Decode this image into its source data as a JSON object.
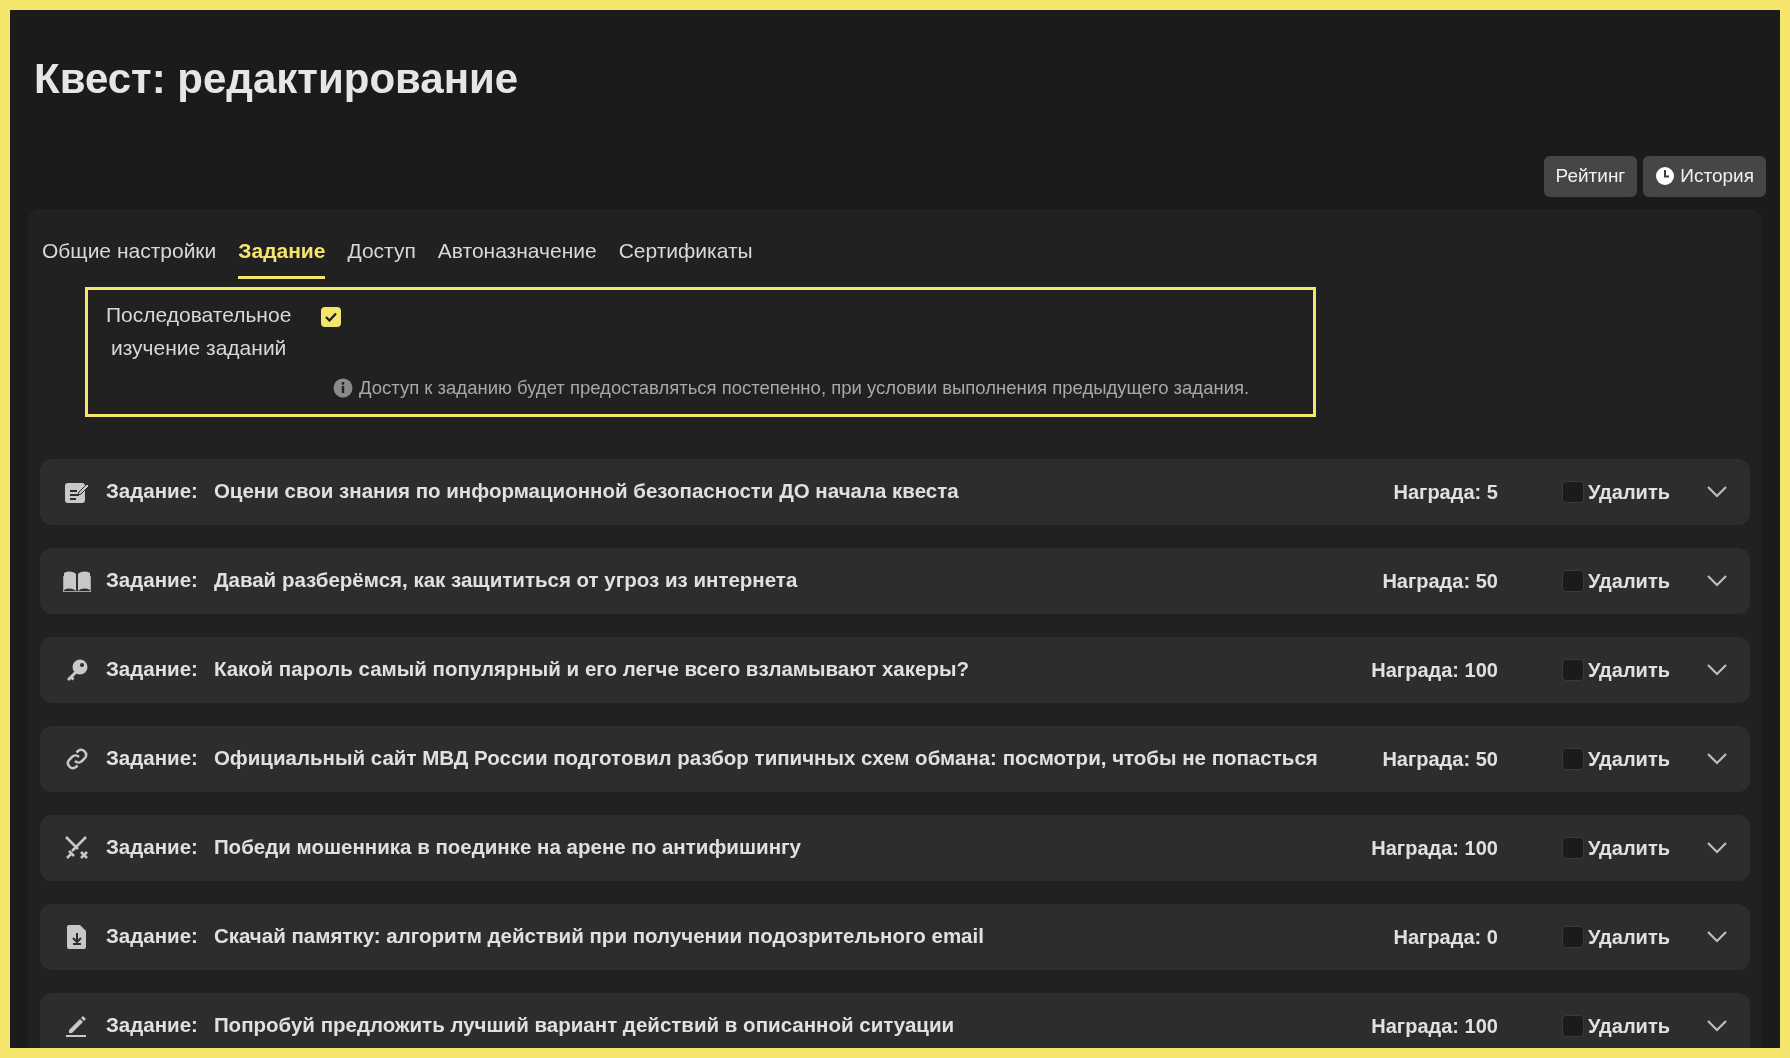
{
  "title": "Квест: редактирование",
  "header_buttons": [
    {
      "kind": "plain",
      "label": "Рейтинг"
    },
    {
      "kind": "history",
      "label": "История"
    }
  ],
  "tabs": [
    {
      "label": "Общие настройки",
      "selected": false
    },
    {
      "label": "Задание",
      "selected": true
    },
    {
      "label": "Доступ",
      "selected": false
    },
    {
      "label": "Автоназначение",
      "selected": false
    },
    {
      "label": "Сертификаты",
      "selected": false
    }
  ],
  "sequential": {
    "label_lines": [
      "Последовательное",
      "изучение заданий"
    ],
    "checked": true,
    "hint": "Доступ к заданию будет предоставляться постепенно, при условии выполнения предыдущего задания."
  },
  "tasks": [
    {
      "kind": "grade",
      "prefix": "Задание:",
      "title": "Оцени свои знания по информационной безопасности ДО начала квеста",
      "reward": "Награда: 5",
      "delete_label": "Удалить",
      "delete_checked": false
    },
    {
      "kind": "book",
      "prefix": "Задание:",
      "title": "Давай разберёмся, как защититься от угроз из интернета",
      "reward": "Награда: 50",
      "delete_label": "Удалить",
      "delete_checked": false
    },
    {
      "kind": "key",
      "prefix": "Задание:",
      "title": "Какой пароль самый популярный и его легче всего взламывают хакеры?",
      "reward": "Награда: 100",
      "delete_label": "Удалить",
      "delete_checked": false
    },
    {
      "kind": "link",
      "prefix": "Задание:",
      "title": "Официальный сайт МВД России подготовил разбор типичных схем обмана: посмотри, чтобы не попасться",
      "reward": "Награда: 50",
      "delete_label": "Удалить",
      "delete_checked": false
    },
    {
      "kind": "swords",
      "prefix": "Задание:",
      "title": "Победи мошенника в поединке на арене по антифишингу",
      "reward": "Награда: 100",
      "delete_label": "Удалить",
      "delete_checked": false
    },
    {
      "kind": "download",
      "prefix": "Задание:",
      "title": "Скачай памятку: алгоритм действий при получении подозрительного email",
      "reward": "Награда: 0",
      "delete_label": "Удалить",
      "delete_checked": false
    },
    {
      "kind": "pencil",
      "prefix": "Задание:",
      "title": "Попробуй предложить лучший вариант действий в описанной ситуации",
      "reward": "Награда: 100",
      "delete_label": "Удалить",
      "delete_checked": false
    }
  ]
}
